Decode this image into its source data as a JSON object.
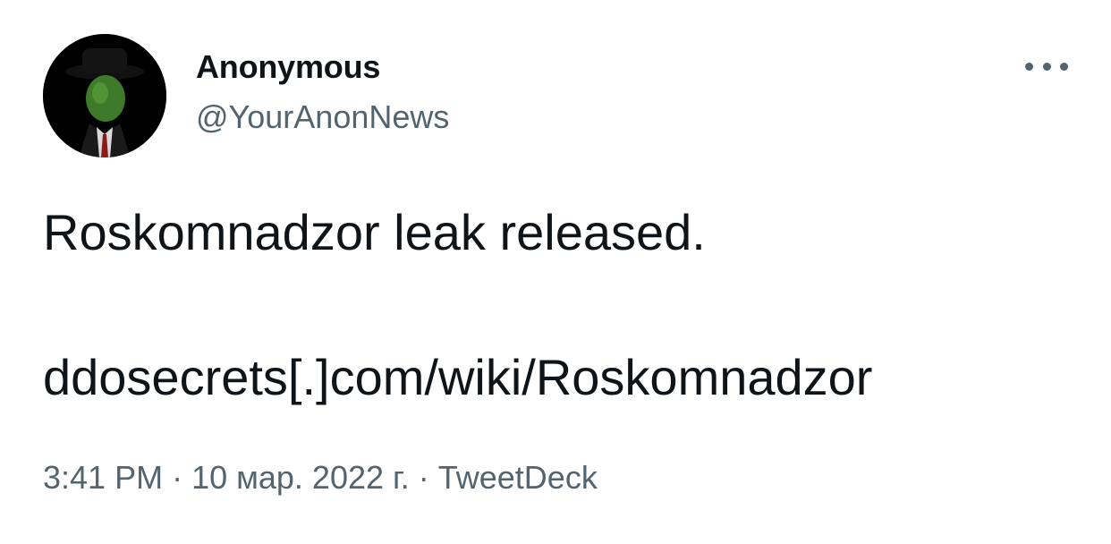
{
  "author": {
    "display_name": "Anonymous",
    "handle": "@YourAnonNews",
    "avatar_icon": "masked-figure-avatar"
  },
  "tweet": {
    "text_line1": "Roskomnadzor leak released.",
    "text_line2": "ddosecrets[.]com/wiki/Roskomnadzor"
  },
  "meta": {
    "time": "3:41 PM",
    "date": "10 мар. 2022 г.",
    "source": "TweetDeck",
    "separator": "·"
  },
  "menu": {
    "icon": "more-options-icon"
  },
  "colors": {
    "text_primary": "#0f1419",
    "text_secondary": "#536471",
    "background": "#ffffff"
  }
}
